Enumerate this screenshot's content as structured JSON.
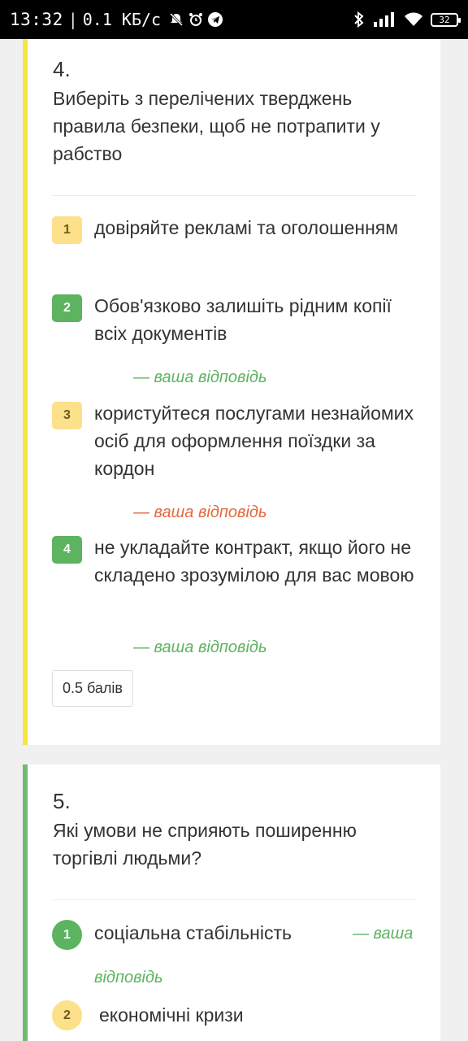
{
  "status_bar": {
    "time": "13:32",
    "speed": "0.1 КБ/с",
    "battery": "32",
    "icons": [
      "mute-icon",
      "alarm-icon",
      "telegram-icon",
      "bluetooth-icon",
      "signal-icon",
      "wifi-icon",
      "battery-icon"
    ]
  },
  "question4": {
    "number": "4.",
    "text": "Виберіть з перелічених тверджень правила безпеки, щоб не потрапити у рабство",
    "accent_color": "#f6e443",
    "options": [
      {
        "num": "1",
        "text": "довіряйте рекламі та оголошенням",
        "badge_color": "#fde08a",
        "answer": ""
      },
      {
        "num": "2",
        "text": "Обов'язково залишіть рідним копії всіх документів",
        "badge_color": "#5cb360",
        "answer": "— ваша відповідь"
      },
      {
        "num": "3",
        "text": "користуйтеся послугами незнайомих осіб для оформлення поїздки за кордон",
        "badge_color": "#fde08a",
        "answer": "— ваша відповідь"
      },
      {
        "num": "4",
        "text": "не укладайте контракт, якщо його не складено зрозумілою для вас мовою",
        "badge_color": "#5cb360",
        "answer": "— ваша відповідь"
      }
    ],
    "score": "0.5 балів"
  },
  "question5": {
    "number": "5.",
    "text": "Які умови не сприяють поширенню торгівлі людьми?",
    "accent_color": "#6ebc70",
    "options": [
      {
        "num": "1",
        "text": "соціальна стабільність",
        "answer_part1": "— ваша",
        "answer_part2": "відповідь"
      },
      {
        "num": "2",
        "text": "економічні кризи"
      }
    ]
  }
}
